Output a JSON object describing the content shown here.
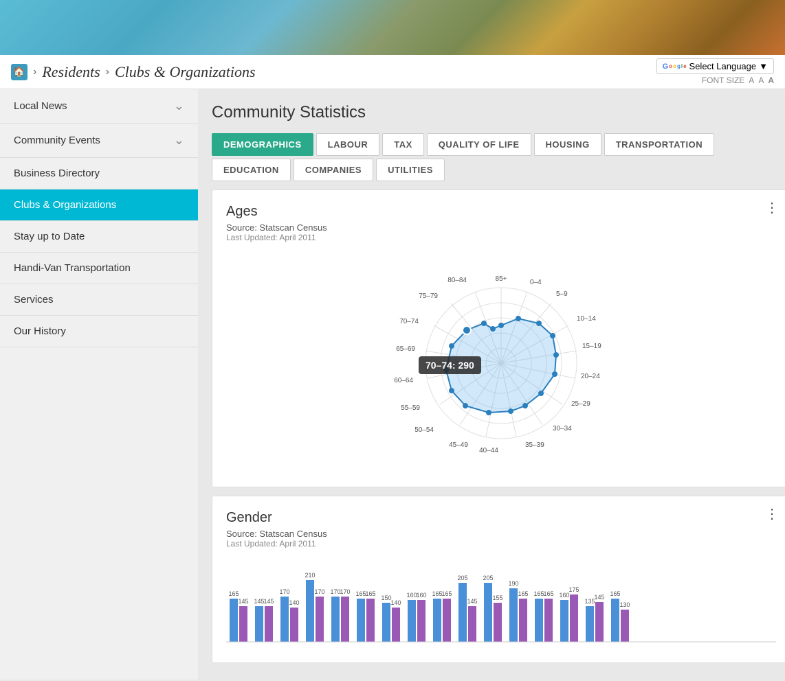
{
  "banner": {
    "alt": "Community banner image"
  },
  "topbar": {
    "home_icon": "🏠",
    "breadcrumbs": [
      {
        "label": "Residents"
      },
      {
        "label": "Clubs & Organizations"
      }
    ],
    "select_language_label": "Select Language",
    "font_size_label": "FONT SIZE",
    "font_sizes": [
      "A",
      "A",
      "A"
    ]
  },
  "sidebar": {
    "items": [
      {
        "id": "local-news",
        "label": "Local News",
        "has_chevron": true,
        "active": false
      },
      {
        "id": "community-events",
        "label": "Community Events",
        "has_chevron": true,
        "active": false
      },
      {
        "id": "business-directory",
        "label": "Business Directory",
        "has_chevron": false,
        "active": false
      },
      {
        "id": "clubs-organizations",
        "label": "Clubs & Organizations",
        "has_chevron": false,
        "active": true
      },
      {
        "id": "stay-up-to-date",
        "label": "Stay up to Date",
        "has_chevron": false,
        "active": false
      },
      {
        "id": "handi-van",
        "label": "Handi-Van Transportation",
        "has_chevron": false,
        "active": false
      },
      {
        "id": "services",
        "label": "Services",
        "has_chevron": false,
        "active": false
      },
      {
        "id": "our-history",
        "label": "Our History",
        "has_chevron": false,
        "active": false
      }
    ]
  },
  "main": {
    "page_title": "Community Statistics",
    "tabs": [
      {
        "id": "demographics",
        "label": "DEMOGRAPHICS",
        "active": true
      },
      {
        "id": "labour",
        "label": "LABOUR",
        "active": false
      },
      {
        "id": "tax",
        "label": "TAX",
        "active": false
      },
      {
        "id": "quality-of-life",
        "label": "QUALITY OF LIFE",
        "active": false
      },
      {
        "id": "housing",
        "label": "HOUSING",
        "active": false
      },
      {
        "id": "transportation",
        "label": "TRANSPORTATION",
        "active": false
      },
      {
        "id": "education",
        "label": "EDUCATION",
        "active": false
      },
      {
        "id": "companies",
        "label": "COMPANIES",
        "active": false
      },
      {
        "id": "utilities",
        "label": "UTILITIES",
        "active": false
      }
    ],
    "ages_chart": {
      "title": "Ages",
      "source": "Source: Statscan Census",
      "updated": "Last Updated: April 2011",
      "tooltip": "70–74: 290",
      "labels": [
        "0–4",
        "5–9",
        "10–14",
        "15–19",
        "20–24",
        "25–29",
        "30–34",
        "35–39",
        "40–44",
        "45–49",
        "50–54",
        "55–59",
        "60–64",
        "65–69",
        "70–74",
        "75–79",
        "80–84",
        "85+"
      ]
    },
    "gender_chart": {
      "title": "Gender",
      "source": "Source: Statscan Census",
      "updated": "Last Updated: April 2011",
      "bars": [
        {
          "blue": 165,
          "purple": 145,
          "label": ""
        },
        {
          "blue": 145,
          "purple": 145,
          "label": ""
        },
        {
          "blue": 170,
          "purple": 140,
          "label": ""
        },
        {
          "blue": 210,
          "purple": 170,
          "label": ""
        },
        {
          "blue": 170,
          "purple": 170,
          "label": ""
        },
        {
          "blue": 165,
          "purple": 165,
          "label": ""
        },
        {
          "blue": 150,
          "purple": 140,
          "label": ""
        },
        {
          "blue": 160,
          "purple": 160,
          "label": ""
        },
        {
          "blue": 165,
          "purple": 165,
          "label": ""
        },
        {
          "blue": 205,
          "purple": 145,
          "label": ""
        },
        {
          "blue": 205,
          "purple": 155,
          "label": ""
        },
        {
          "blue": 190,
          "purple": 165,
          "label": ""
        },
        {
          "blue": 165,
          "purple": 165,
          "label": ""
        },
        {
          "blue": 160,
          "purple": 175,
          "label": ""
        },
        {
          "blue": 135,
          "purple": 145,
          "label": ""
        },
        {
          "blue": 165,
          "purple": 130,
          "label": ""
        }
      ]
    }
  }
}
